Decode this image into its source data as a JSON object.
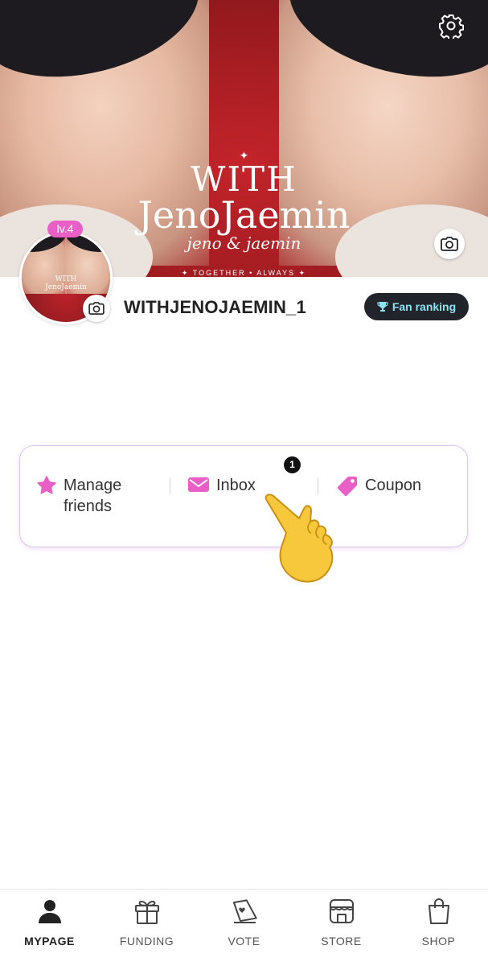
{
  "cover": {
    "star": "✦",
    "title_line1": "WITH",
    "title_line2": "JenoJaemin",
    "title_script": "jeno & jaemin",
    "tagline": "✦ TOGETHER • ALWAYS ✦",
    "icons": {
      "settings": "gear-icon",
      "camera": "camera-icon"
    }
  },
  "avatar_art": {
    "title_line1": "WITH",
    "title_line2": "JenoJaemin"
  },
  "profile": {
    "level": "lv.4",
    "username": "WITHJENOJAEMIN_1",
    "fan_ranking_label": "Fan ranking",
    "fan_ranking_icon": "trophy-icon"
  },
  "menu": {
    "items": [
      {
        "label": "Manage friends",
        "icon": "star-icon"
      },
      {
        "label": "Inbox",
        "icon": "envelope-icon"
      },
      {
        "label": "Coupon",
        "icon": "tag-icon"
      }
    ],
    "inbox_badge": "1"
  },
  "overlay": {
    "icon": "pointing-hand-icon"
  },
  "bottom_nav": {
    "active": "MYPAGE",
    "items": [
      {
        "label": "MYPAGE",
        "icon": "person-icon"
      },
      {
        "label": "FUNDING",
        "icon": "gift-icon"
      },
      {
        "label": "VOTE",
        "icon": "ballot-icon"
      },
      {
        "label": "STORE",
        "icon": "storefront-icon"
      },
      {
        "label": "SHOP",
        "icon": "shopping-bag-icon"
      }
    ]
  },
  "colors": {
    "accent": "#E95FC5",
    "fan_ranking_bg": "#22242B",
    "fan_ranking_text": "#8BE4F2",
    "card_border": "#E1C4EC",
    "cover_red": "#C4242B"
  }
}
